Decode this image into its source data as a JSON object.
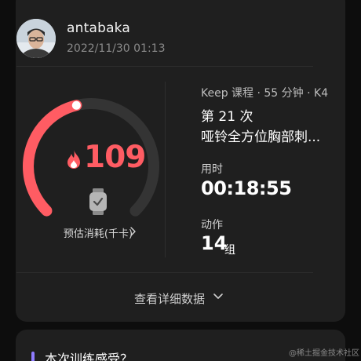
{
  "colors": {
    "background": "#0d0d0d",
    "card": "#1f1f1f",
    "ring_active": "#ff5c63",
    "ring_track": "#343434",
    "accent_bar": "#8f7bff"
  },
  "post": {
    "username": "antabaka",
    "datetime": "2022/11/30 01:13"
  },
  "calories": {
    "value": "109",
    "label": "预估消耗(千卡)",
    "ring_progress": 0.45
  },
  "course": {
    "meta": "Keep 课程 · 55 分钟 · K4",
    "count": "第 21 次",
    "name": "哑铃全方位胸部刺..."
  },
  "stats": {
    "time_label": "用时",
    "time_value": "00:18:55",
    "action_label": "动作",
    "action_value": "14",
    "action_unit": "组"
  },
  "details": {
    "label": "查看详细数据"
  },
  "feedback": {
    "title": "本次训练感受？"
  },
  "watermark": "@稀土掘金技术社区",
  "icons": {
    "avatar": "user-avatar",
    "calories": "flame-icon",
    "device": "smartwatch-icon",
    "calorie_chevron": "chevron-right-icon",
    "details_chevron": "chevron-down-icon"
  }
}
